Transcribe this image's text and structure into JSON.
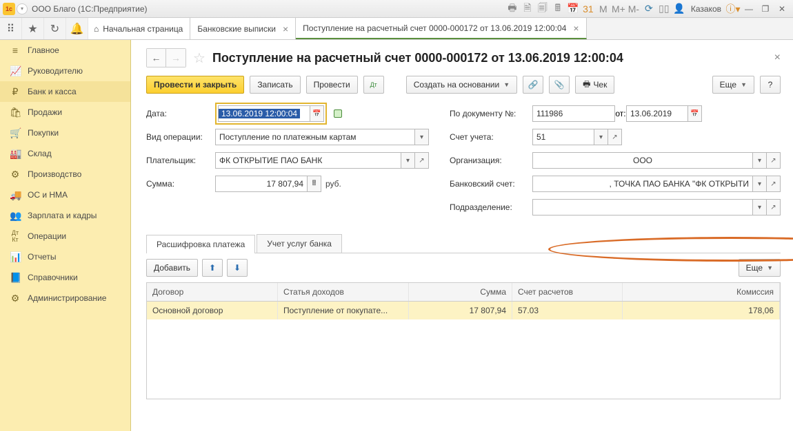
{
  "titlebar": {
    "title": "ООО Благо   (1С:Предприятие)",
    "user": "Казаков"
  },
  "tabs": {
    "home": "Начальная страница",
    "t1": "Банковские выписки",
    "t2": "Поступление на расчетный счет 0000-000172 от 13.06.2019 12:00:04"
  },
  "nav": {
    "main": "Главное",
    "manager": "Руководителю",
    "bank": "Банк и касса",
    "sales": "Продажи",
    "purchases": "Покупки",
    "warehouse": "Склад",
    "production": "Производство",
    "os": "ОС и НМА",
    "salary": "Зарплата и кадры",
    "operations": "Операции",
    "reports": "Отчеты",
    "catalogs": "Справочники",
    "admin": "Администрирование"
  },
  "page": {
    "title": "Поступление на расчетный счет 0000-000172 от 13.06.2019 12:00:04"
  },
  "toolbar": {
    "post_close": "Провести и закрыть",
    "save": "Записать",
    "post": "Провести",
    "create_based": "Создать на основании",
    "check": "Чек",
    "more": "Еще"
  },
  "form": {
    "date_label": "Дата:",
    "date_value": "13.06.2019 12:00:04",
    "op_type_label": "Вид операции:",
    "op_type_value": "Поступление по платежным картам",
    "payer_label": "Плательщик:",
    "payer_value": "ФК ОТКРЫТИЕ ПАО БАНК",
    "sum_label": "Сумма:",
    "sum_value": "17 807,94",
    "sum_unit": "руб.",
    "docnum_label": "По документу №:",
    "docnum_value": "111986",
    "docdate_label": "от:",
    "docdate_value": "13.06.2019",
    "account_label": "Счет учета:",
    "account_value": "51",
    "org_label": "Организация:",
    "org_value": "ООО",
    "bank_label": "Банковский счет:",
    "bank_value": ", ТОЧКА ПАО БАНКА \"ФК ОТКРЫТИ",
    "division_label": "Подразделение:",
    "division_value": ""
  },
  "inner_tabs": {
    "t1": "Расшифровка платежа",
    "t2": "Учет услуг банка"
  },
  "tbl_toolbar": {
    "add": "Добавить",
    "more": "Еще"
  },
  "table": {
    "h1": "Договор",
    "h2": "Статья доходов",
    "h3": "Сумма",
    "h4": "Счет расчетов",
    "h5": "Комиссия",
    "r1": {
      "c1": "Основной договор",
      "c2": "Поступление от покупате...",
      "c3": "17 807,94",
      "c4": "57.03",
      "c5": "178,06"
    }
  }
}
